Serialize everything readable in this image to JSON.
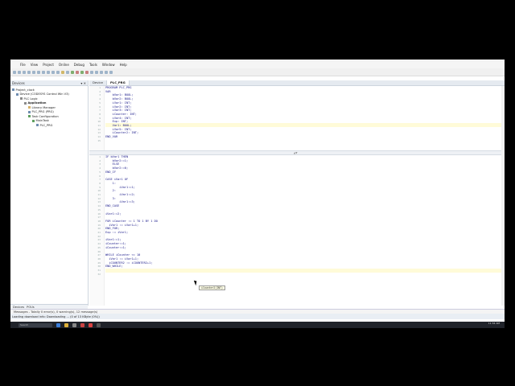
{
  "menu": [
    "File",
    "View",
    "Project",
    "Online",
    "Debug",
    "Tools",
    "Window",
    "Help"
  ],
  "left_panel": {
    "title": "Devices",
    "tree": [
      "Project_clock",
      "Device (CODESYS Control Win V3)",
      "PLC Logic",
      "Application",
      "Library Manager",
      "PLC_PRG (PRG)",
      "Task Configuration",
      "MainTask",
      "PLC_PRG"
    ],
    "bottom_tabs": [
      "Devices",
      "POUs"
    ]
  },
  "tabs": [
    "Device",
    "PLC_PRG"
  ],
  "decl_code": "PROGRAM PLC_PRG\nVAR\n    bVar1: BOOL;\n    bVar2: BOOL;\n    iVar1: INT;\n    iVar2: INT;\n    iVar3: INT;\n    iCounter: INT;\n    iVar4: INT;\n    Exp: INT;\n    Var1: BOOL;\n    iVar5: INT;\n    iCounter2: INT;\nEND_VAR",
  "body_code": "IF bVar1 THEN\n    bVar2:=1;\n    ELSE\n    bVar2:=0;\nEND_IF\n\nCASE iVar1 OF\n    1:\n        iVar1:=1;\n    2:\n        iVar1:=2;\n    3:\n        iVar1:=3;\nEND_CASE\n\niVar1:=2;\n\nFOR iCounter := 1 TO 1 BY 1 DO\n  iVar1 := iVar1+1;\nEND_FOR;\nExp := iVar1;\n\niVar1:=1;\niCounter:=1;\niCounter:=1;\n\nWHILE iCounter <= 10\n  iVar1 := iVar1+1;\n  iCOUNTER2 := iCOUNTER2+1;\nEND_WHILE;",
  "tooltip": "iCounter2(INT)",
  "messages": "Messages - Totally 0 error(s), 0 warning(s), 12 message(s)",
  "status": "Loading download info: Downloading ... (0 of 13 KByte (0%))",
  "taskbar": {
    "search_placeholder": "Search",
    "clock": "11:34 AM"
  }
}
